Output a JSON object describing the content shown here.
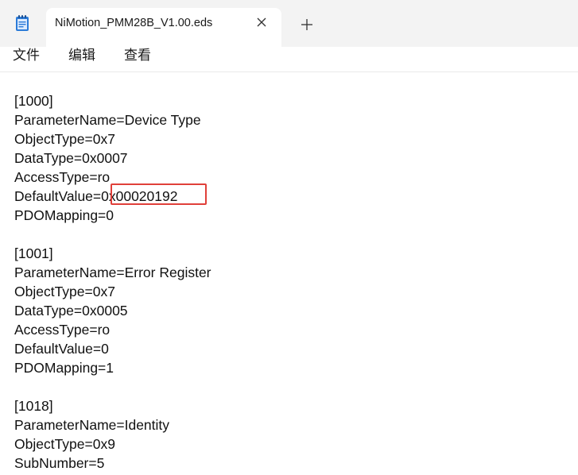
{
  "tab": {
    "title": "NiMotion_PMM28B_V1.00.eds"
  },
  "menu": {
    "items": [
      "文件",
      "编辑",
      "查看"
    ]
  },
  "editor": {
    "lines": [
      "[1000]",
      "ParameterName=Device Type",
      "ObjectType=0x7",
      "DataType=0x0007",
      "AccessType=ro",
      "DefaultValue=0x00020192",
      "PDOMapping=0",
      "",
      "[1001]",
      "ParameterName=Error Register",
      "ObjectType=0x7",
      "DataType=0x0005",
      "AccessType=ro",
      "DefaultValue=0",
      "PDOMapping=1",
      "",
      "[1018]",
      "ParameterName=Identity",
      "ObjectType=0x9",
      "SubNumber=5"
    ]
  },
  "icons": {
    "app": "notepad-icon",
    "close": "close-icon",
    "add": "plus-icon"
  },
  "colors": {
    "highlight": "#e0403a",
    "titlebar": "#f3f3f3",
    "icon_blue": "#2b7bd8"
  }
}
